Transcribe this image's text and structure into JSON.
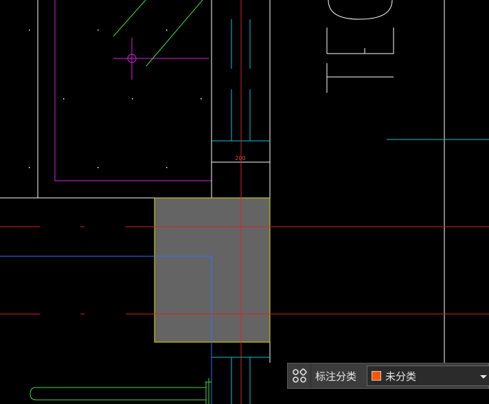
{
  "drawing": {
    "dimension_text": "200",
    "colors": {
      "background": "#000000",
      "line_white": "#ffffff",
      "line_red": "#e02020",
      "line_cyan": "#00c8e0",
      "line_magenta": "#e020e0",
      "line_green": "#40e040",
      "line_yellow": "#e0e000",
      "line_blue": "#3070ff",
      "hatch_gray": "#646464"
    }
  },
  "category_panel": {
    "icon": "grid-categories-icon",
    "label": "标注分类",
    "select_value": "未分类",
    "swatch_color": "#ff5500",
    "dropdown_icon": "chevron-down-icon"
  }
}
